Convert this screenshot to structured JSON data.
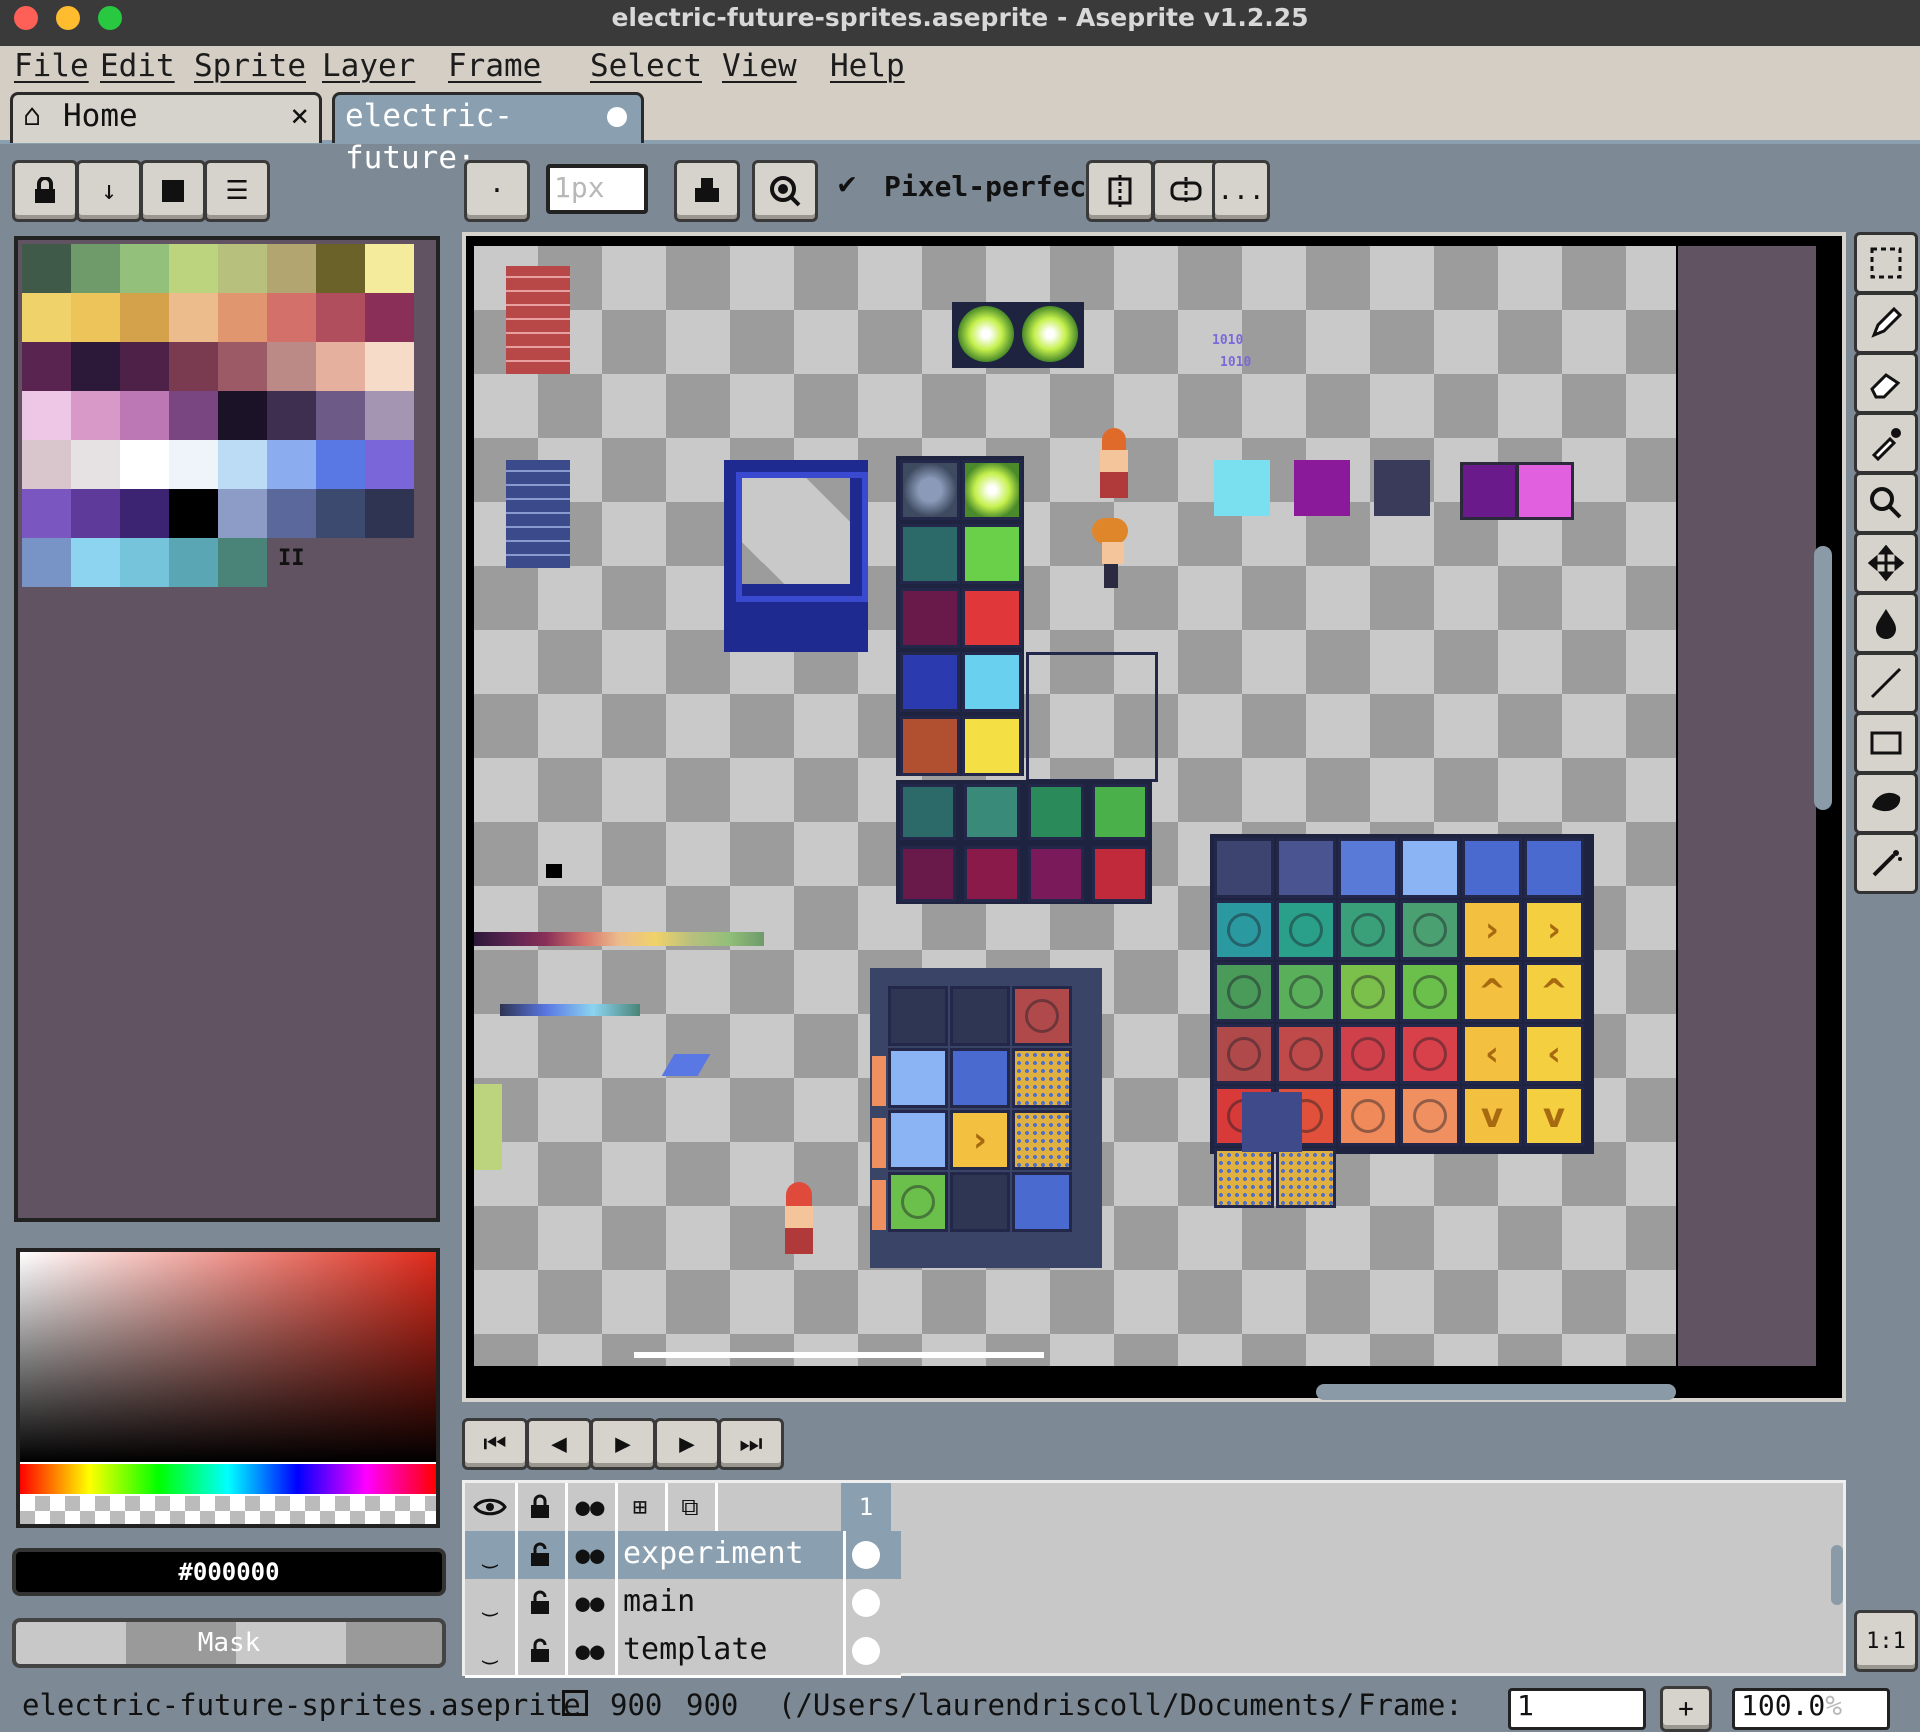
{
  "window": {
    "title": "electric-future-sprites.aseprite - Aseprite v1.2.25"
  },
  "menu": [
    "File",
    "Edit",
    "Sprite",
    "Layer",
    "Frame",
    "Select",
    "View",
    "Help"
  ],
  "tabs": {
    "home": "Home",
    "home_close": "×",
    "doc": "electric-future·"
  },
  "toolbar": {
    "brush_size": "1px",
    "pixel_perfect_label": "Pixel-perfect",
    "pixel_perfect_check": "✔",
    "more": "..."
  },
  "palette": {
    "colors": [
      "#3f5a48",
      "#6f9a6a",
      "#93c07a",
      "#bcd47e",
      "#b8c07e",
      "#b3a56f",
      "#6a6228",
      "#f4ec9c",
      "#f0d26a",
      "#ecc45a",
      "#d4a24a",
      "#ecbc8c",
      "#e0966e",
      "#d4706a",
      "#b04e5e",
      "#8a3058",
      "#5a2450",
      "#2c1838",
      "#4e2248",
      "#7a3a50",
      "#9c5a66",
      "#bc8a86",
      "#e6b09e",
      "#f6dcc8",
      "#eec6e6",
      "#d898c8",
      "#bc78b4",
      "#7a4682",
      "#1c1228",
      "#3e2e50",
      "#6e5a86",
      "#a496b2",
      "#d8c6cc",
      "#e6e2e4",
      "#ffffff",
      "#eef4fa",
      "#bcdcf6",
      "#8cacf0",
      "#5a78e4",
      "#7a66d8",
      "#7a56c0",
      "#5e3a9a",
      "#3c2472",
      "#000000",
      "#8c9cc6",
      "#5a689c",
      "#3c4a70",
      "#2e3452",
      "#7894c6",
      "#8cd4f0",
      "#76c4dc",
      "#5aa6b4",
      "#4a8478"
    ],
    "handle": "II"
  },
  "color": {
    "hex": "#000000",
    "mask_label": "Mask",
    "fg": "#000000"
  },
  "timeline_controls": [
    "first-frame",
    "prev-frame",
    "play",
    "next-frame",
    "last-frame"
  ],
  "layers": {
    "frame_header": "1",
    "rows": [
      {
        "name": "experiment"
      },
      {
        "name": "main"
      },
      {
        "name": "template"
      }
    ]
  },
  "status": {
    "file": "electric-future-sprites.aseprite",
    "width": "900",
    "height": "900",
    "path": "(/Users/laurendriscoll/Documents/",
    "frame_label": "Frame:",
    "frame_value": "1",
    "zoom": "100.0",
    "zoom_unit": "%",
    "one_to_one": "1:1",
    "add": "+"
  },
  "canvas_text": {
    "binary_a": "1010",
    "binary_b": "1010"
  }
}
